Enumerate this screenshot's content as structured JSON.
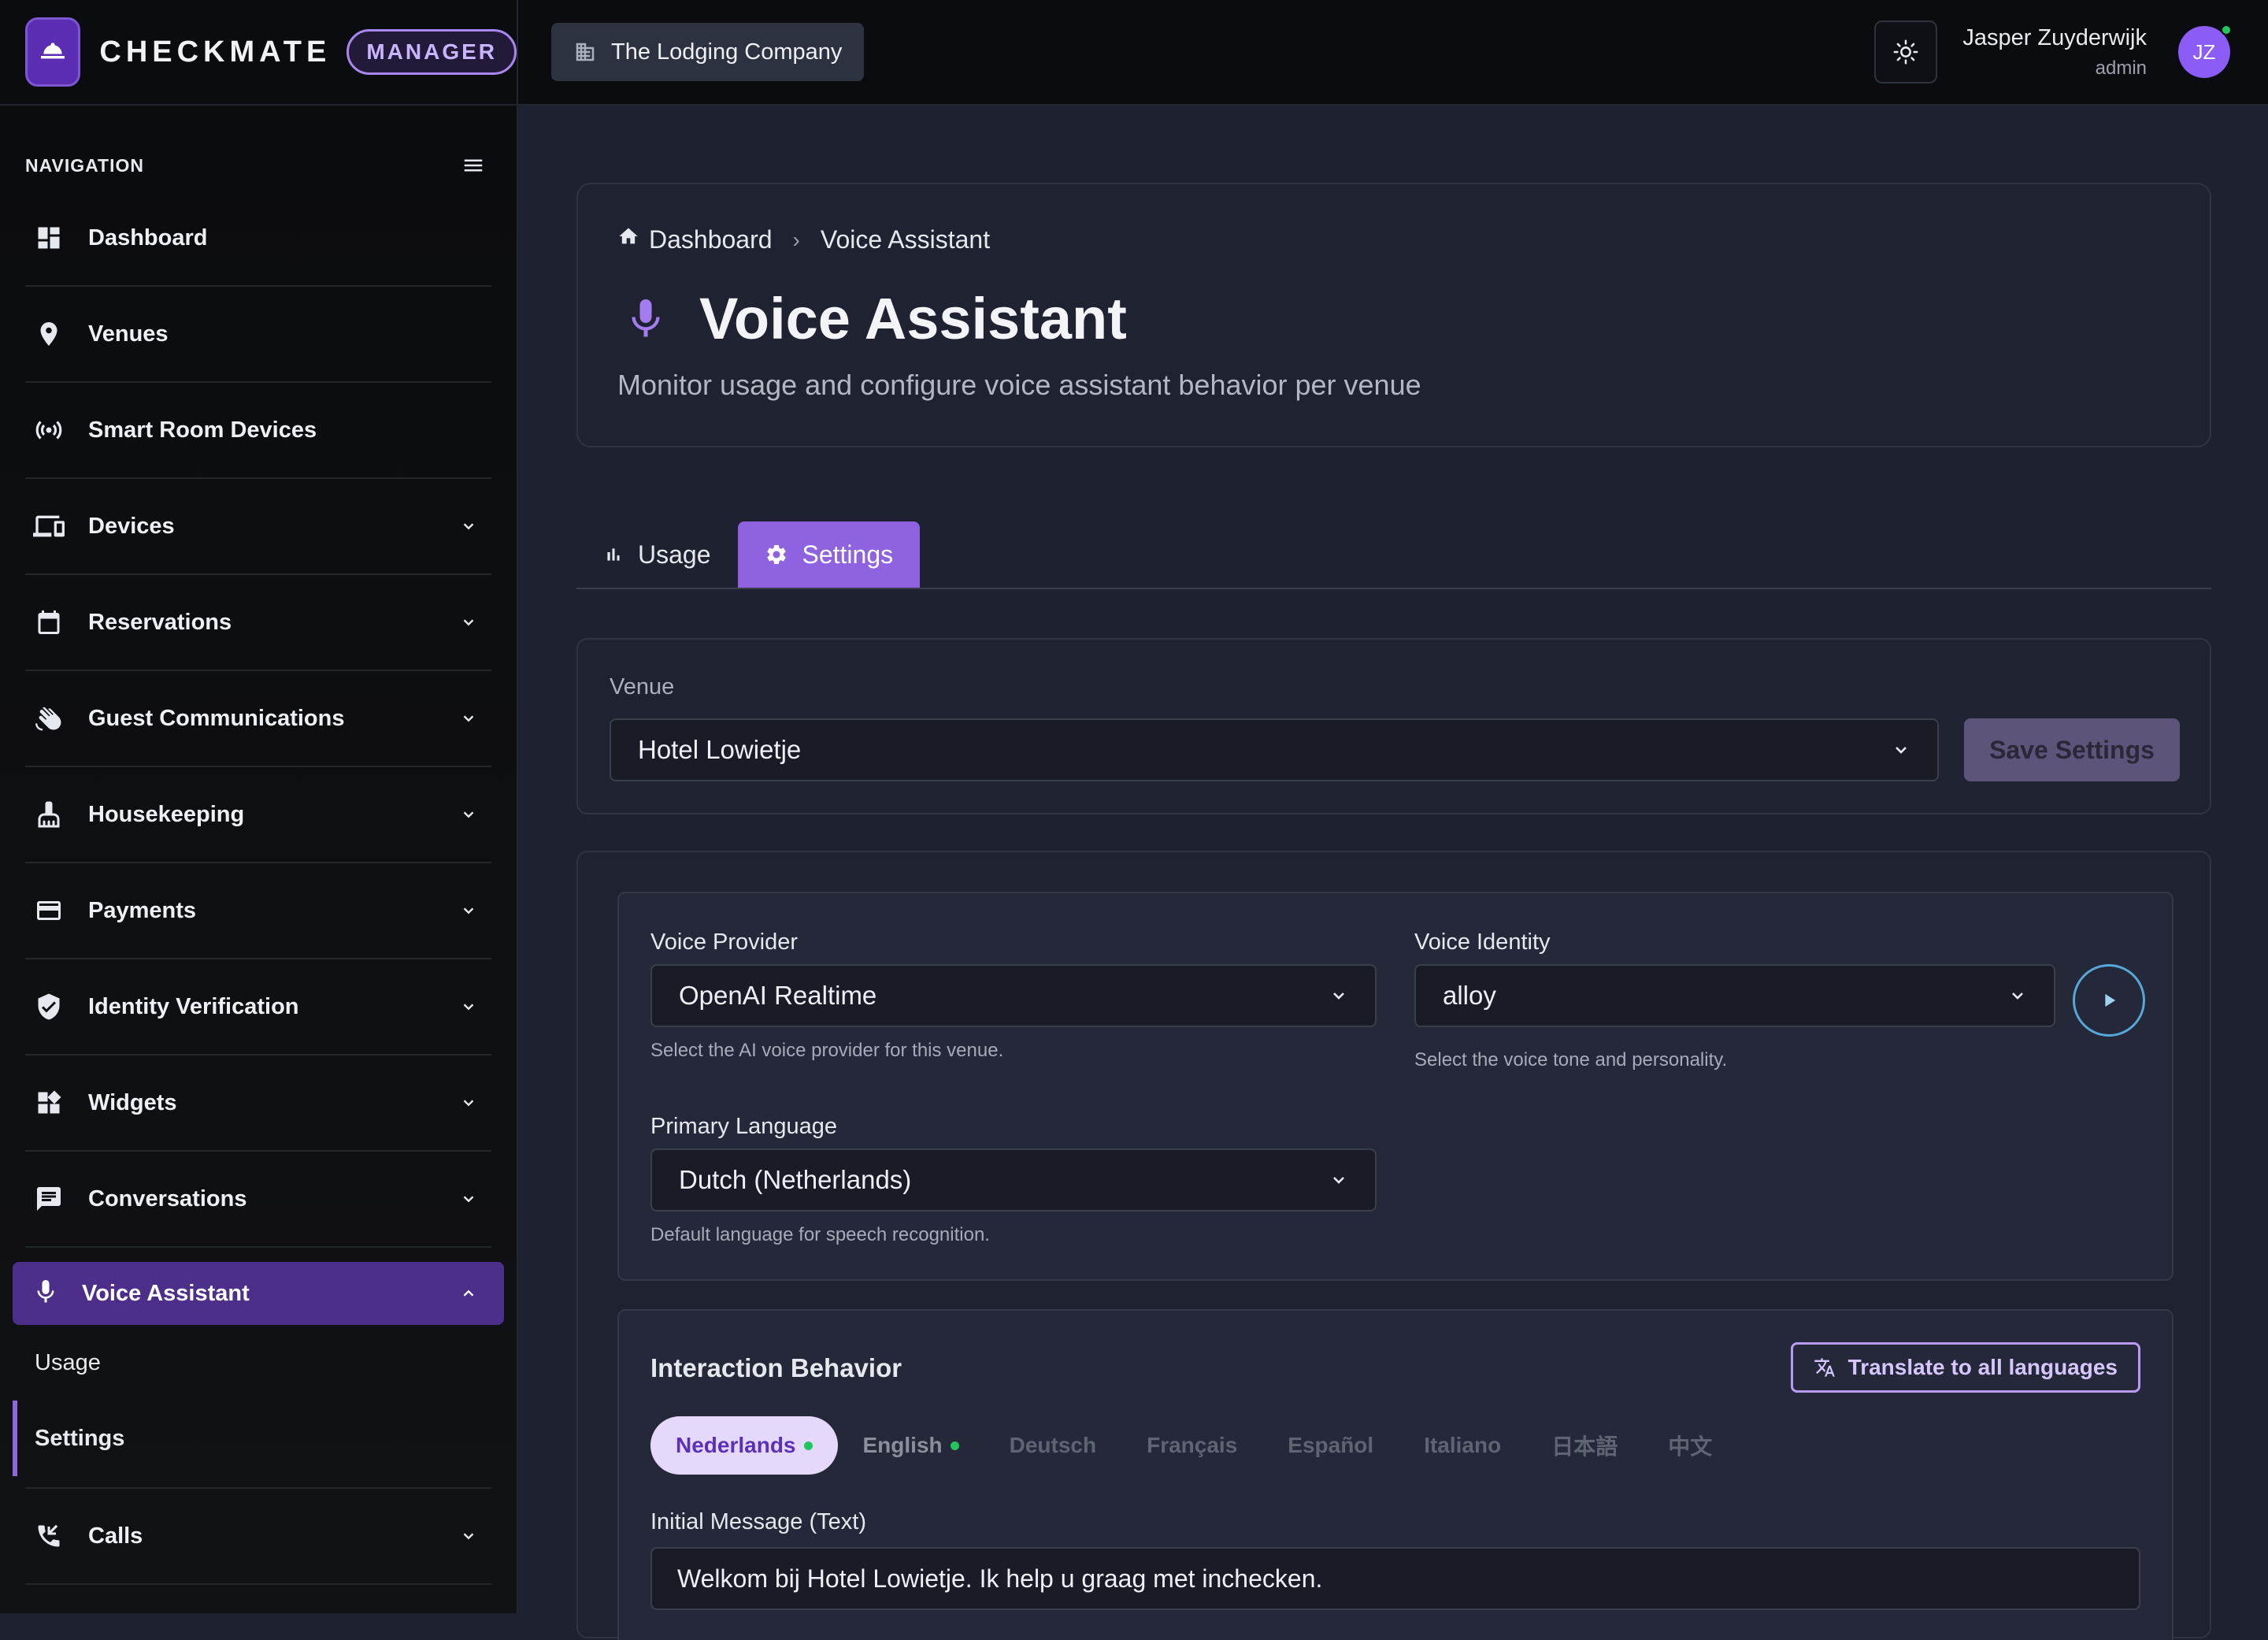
{
  "app": {
    "brand_name": "CHECKMATE",
    "role_badge": "MANAGER",
    "company": "The Lodging Company"
  },
  "user": {
    "name": "Jasper Zuyderwijk",
    "role": "admin",
    "initials": "JZ"
  },
  "sidebar": {
    "title": "NAVIGATION",
    "items": [
      {
        "label": "Dashboard",
        "icon": "dashboard-icon"
      },
      {
        "label": "Venues",
        "icon": "location-pin-icon"
      },
      {
        "label": "Smart Room Devices",
        "icon": "broadcast-icon"
      },
      {
        "label": "Devices",
        "icon": "devices-icon"
      },
      {
        "label": "Reservations",
        "icon": "calendar-icon"
      },
      {
        "label": "Guest Communications",
        "icon": "waving-hand-icon"
      },
      {
        "label": "Housekeeping",
        "icon": "cleaning-icon"
      },
      {
        "label": "Payments",
        "icon": "credit-card-icon"
      },
      {
        "label": "Identity Verification",
        "icon": "shield-check-icon"
      },
      {
        "label": "Widgets",
        "icon": "widgets-icon"
      },
      {
        "label": "Conversations",
        "icon": "chat-icon"
      }
    ],
    "active_item": {
      "label": "Voice Assistant",
      "icon": "microphone-icon"
    },
    "sub_items": [
      {
        "label": "Usage"
      },
      {
        "label": "Settings"
      }
    ],
    "after_item": {
      "label": "Calls",
      "icon": "phone-calls-icon"
    }
  },
  "breadcrumb": {
    "home": "Dashboard",
    "current": "Voice Assistant"
  },
  "page": {
    "title": "Voice Assistant",
    "subtitle": "Monitor usage and configure voice assistant behavior per venue"
  },
  "tabs": [
    {
      "label": "Usage",
      "active": false
    },
    {
      "label": "Settings",
      "active": true
    }
  ],
  "venue": {
    "label": "Venue",
    "selected": "Hotel Lowietje",
    "save_label": "Save Settings"
  },
  "voice": {
    "provider_label": "Voice Provider",
    "provider_value": "OpenAI Realtime",
    "provider_help": "Select the AI voice provider for this venue.",
    "identity_label": "Voice Identity",
    "identity_value": "alloy",
    "identity_help": "Select the voice tone and personality.",
    "language_label": "Primary Language",
    "language_value": "Dutch (Netherlands)",
    "language_help": "Default language for speech recognition."
  },
  "behavior": {
    "title": "Interaction Behavior",
    "translate_label": "Translate to all languages",
    "languages": [
      {
        "label": "Nederlands",
        "active": true,
        "has_content": true
      },
      {
        "label": "English",
        "active": false,
        "has_content": true
      },
      {
        "label": "Deutsch",
        "active": false,
        "has_content": false
      },
      {
        "label": "Français",
        "active": false,
        "has_content": false
      },
      {
        "label": "Español",
        "active": false,
        "has_content": false
      },
      {
        "label": "Italiano",
        "active": false,
        "has_content": false
      },
      {
        "label": "日本語",
        "active": false,
        "has_content": false
      },
      {
        "label": "中文",
        "active": false,
        "has_content": false
      }
    ],
    "initial_message_label": "Initial Message (Text)",
    "initial_message_value": "Welkom bij Hotel Lowietje. Ik help u graag met inchecken."
  },
  "colors": {
    "accent": "#8f63e0",
    "sidebar_active": "#4c2f8a",
    "status_green": "#22c55e"
  }
}
